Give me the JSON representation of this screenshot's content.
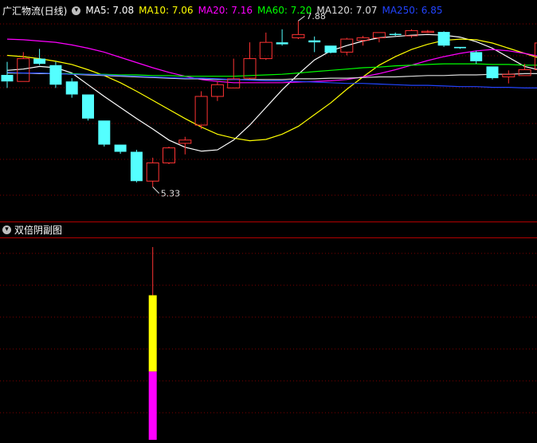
{
  "header": {
    "stock_name": "广汇物流(日线)",
    "ma_items": [
      {
        "label": "MA5: 7.08",
        "color": "#ffffff"
      },
      {
        "label": "MA10: 7.06",
        "color": "#ffff00"
      },
      {
        "label": "MA20: 7.16",
        "color": "#ff00ff"
      },
      {
        "label": "MA60: 7.20",
        "color": "#00ff00"
      },
      {
        "label": "MA120: 7.07",
        "color": "#dcdcdc"
      },
      {
        "label": "MA250: 6.85",
        "color": "#2244ff"
      }
    ]
  },
  "indicator": {
    "title": "双倍阴副图"
  },
  "colors": {
    "up": "#ff3333",
    "down": "#54ffff",
    "grid": "#800000",
    "frame": "#b00000",
    "bar_top": "#ffff00",
    "bar_bottom": "#ff00ff",
    "bar_line": "#ff3333"
  },
  "chart_data": {
    "type": "candlestick",
    "ylim": [
      4.8,
      8.2
    ],
    "candles": [
      {
        "o": 7.05,
        "h": 7.25,
        "l": 6.85,
        "c": 6.95
      },
      {
        "o": 6.95,
        "h": 7.4,
        "l": 6.95,
        "c": 7.3
      },
      {
        "o": 7.3,
        "h": 7.45,
        "l": 7.2,
        "c": 7.22
      },
      {
        "o": 7.2,
        "h": 7.25,
        "l": 6.85,
        "c": 6.9
      },
      {
        "o": 6.95,
        "h": 7.0,
        "l": 6.7,
        "c": 6.75
      },
      {
        "o": 6.75,
        "h": 6.75,
        "l": 6.35,
        "c": 6.38
      },
      {
        "o": 6.35,
        "h": 6.35,
        "l": 5.95,
        "c": 5.98
      },
      {
        "o": 5.98,
        "h": 5.98,
        "l": 5.84,
        "c": 5.87
      },
      {
        "o": 5.87,
        "h": 5.9,
        "l": 5.4,
        "c": 5.42
      },
      {
        "o": 5.42,
        "h": 5.78,
        "l": 5.33,
        "c": 5.7
      },
      {
        "o": 5.7,
        "h": 5.95,
        "l": 5.68,
        "c": 5.93
      },
      {
        "o": 6.0,
        "h": 6.1,
        "l": 5.83,
        "c": 6.05
      },
      {
        "o": 6.28,
        "h": 6.8,
        "l": 6.22,
        "c": 6.72
      },
      {
        "o": 6.72,
        "h": 6.95,
        "l": 6.65,
        "c": 6.9
      },
      {
        "o": 6.85,
        "h": 7.3,
        "l": 6.85,
        "c": 6.99
      },
      {
        "o": 7.0,
        "h": 7.55,
        "l": 6.98,
        "c": 7.3
      },
      {
        "o": 7.3,
        "h": 7.7,
        "l": 7.28,
        "c": 7.55
      },
      {
        "o": 7.55,
        "h": 7.75,
        "l": 7.5,
        "c": 7.52
      },
      {
        "o": 7.62,
        "h": 7.88,
        "l": 7.6,
        "c": 7.67
      },
      {
        "o": 7.58,
        "h": 7.64,
        "l": 7.4,
        "c": 7.55
      },
      {
        "o": 7.5,
        "h": 7.5,
        "l": 7.38,
        "c": 7.39
      },
      {
        "o": 7.4,
        "h": 7.62,
        "l": 7.35,
        "c": 7.6
      },
      {
        "o": 7.58,
        "h": 7.65,
        "l": 7.5,
        "c": 7.62
      },
      {
        "o": 7.62,
        "h": 7.7,
        "l": 7.55,
        "c": 7.7
      },
      {
        "o": 7.68,
        "h": 7.7,
        "l": 7.65,
        "c": 7.67
      },
      {
        "o": 7.65,
        "h": 7.75,
        "l": 7.62,
        "c": 7.73
      },
      {
        "o": 7.72,
        "h": 7.74,
        "l": 7.7,
        "c": 7.72
      },
      {
        "o": 7.71,
        "h": 7.72,
        "l": 7.48,
        "c": 7.5
      },
      {
        "o": 7.48,
        "h": 7.48,
        "l": 7.45,
        "c": 7.46
      },
      {
        "o": 7.4,
        "h": 7.42,
        "l": 7.22,
        "c": 7.26
      },
      {
        "o": 7.18,
        "h": 7.18,
        "l": 6.98,
        "c": 7.0
      },
      {
        "o": 7.02,
        "h": 7.12,
        "l": 6.92,
        "c": 7.06
      },
      {
        "o": 7.04,
        "h": 7.22,
        "l": 7.04,
        "c": 7.13
      },
      {
        "o": 7.13,
        "h": 7.56,
        "l": 7.1,
        "c": 7.54
      }
    ],
    "ma_lines": [
      {
        "name": "MA5",
        "color": "#ffffff",
        "values": [
          7.12,
          7.14,
          7.18,
          7.16,
          7.08,
          6.9,
          6.72,
          6.55,
          6.38,
          6.22,
          6.05,
          5.94,
          5.88,
          5.9,
          6.05,
          6.28,
          6.55,
          6.82,
          7.06,
          7.28,
          7.42,
          7.5,
          7.57,
          7.62,
          7.64,
          7.66,
          7.67,
          7.66,
          7.63,
          7.56,
          7.46,
          7.32,
          7.18,
          7.12
        ]
      },
      {
        "name": "MA10",
        "color": "#ffff00",
        "values": [
          7.35,
          7.33,
          7.3,
          7.26,
          7.21,
          7.13,
          7.04,
          6.93,
          6.8,
          6.66,
          6.52,
          6.38,
          6.25,
          6.14,
          6.08,
          6.04,
          6.06,
          6.14,
          6.26,
          6.44,
          6.62,
          6.83,
          7.02,
          7.2,
          7.33,
          7.44,
          7.52,
          7.58,
          7.6,
          7.59,
          7.54,
          7.46,
          7.38,
          7.3
        ]
      },
      {
        "name": "MA20",
        "color": "#ff00ff",
        "values": [
          7.6,
          7.59,
          7.57,
          7.55,
          7.51,
          7.46,
          7.4,
          7.32,
          7.24,
          7.16,
          7.09,
          7.03,
          6.98,
          6.95,
          6.93,
          6.93,
          6.93,
          6.93,
          6.94,
          6.95,
          6.96,
          6.98,
          7.02,
          7.07,
          7.13,
          7.2,
          7.27,
          7.33,
          7.38,
          7.42,
          7.44,
          7.42,
          7.38,
          7.33
        ]
      },
      {
        "name": "MA60",
        "color": "#00ff00",
        "values": [
          7.08,
          7.08,
          7.08,
          7.07,
          7.07,
          7.06,
          7.06,
          7.05,
          7.05,
          7.04,
          7.04,
          7.03,
          7.03,
          7.03,
          7.03,
          7.04,
          7.05,
          7.06,
          7.08,
          7.1,
          7.12,
          7.14,
          7.16,
          7.17,
          7.19,
          7.2,
          7.21,
          7.22,
          7.22,
          7.22,
          7.21,
          7.21,
          7.2,
          7.2
        ]
      },
      {
        "name": "MA120",
        "color": "#dcdcdc",
        "values": [
          7.08,
          7.08,
          7.07,
          7.07,
          7.06,
          7.05,
          7.04,
          7.03,
          7.02,
          7.01,
          7.0,
          6.99,
          6.99,
          6.98,
          6.98,
          6.98,
          6.98,
          6.98,
          6.99,
          6.99,
          7.0,
          7.0,
          7.01,
          7.02,
          7.02,
          7.03,
          7.04,
          7.04,
          7.05,
          7.05,
          7.06,
          7.06,
          7.07,
          7.07
        ]
      },
      {
        "name": "MA250",
        "color": "#2244ff",
        "values": [
          7.09,
          7.08,
          7.08,
          7.07,
          7.06,
          7.06,
          7.05,
          7.04,
          7.03,
          7.02,
          7.01,
          7.0,
          7.0,
          6.99,
          6.98,
          6.97,
          6.96,
          6.96,
          6.95,
          6.94,
          6.93,
          6.92,
          6.92,
          6.91,
          6.9,
          6.89,
          6.89,
          6.88,
          6.87,
          6.87,
          6.86,
          6.86,
          6.85,
          6.85
        ]
      }
    ],
    "annotations": [
      {
        "label": "7.88",
        "candle_index": 18,
        "kind": "high"
      },
      {
        "label": "5.33",
        "candle_index": 9,
        "kind": "low"
      }
    ],
    "indicator_bar": {
      "candle_index": 9,
      "ylim": [
        0,
        10
      ],
      "line_top": 9.6,
      "yellow_top": 7.2,
      "split": 3.4,
      "magenta_bottom": 0
    }
  }
}
